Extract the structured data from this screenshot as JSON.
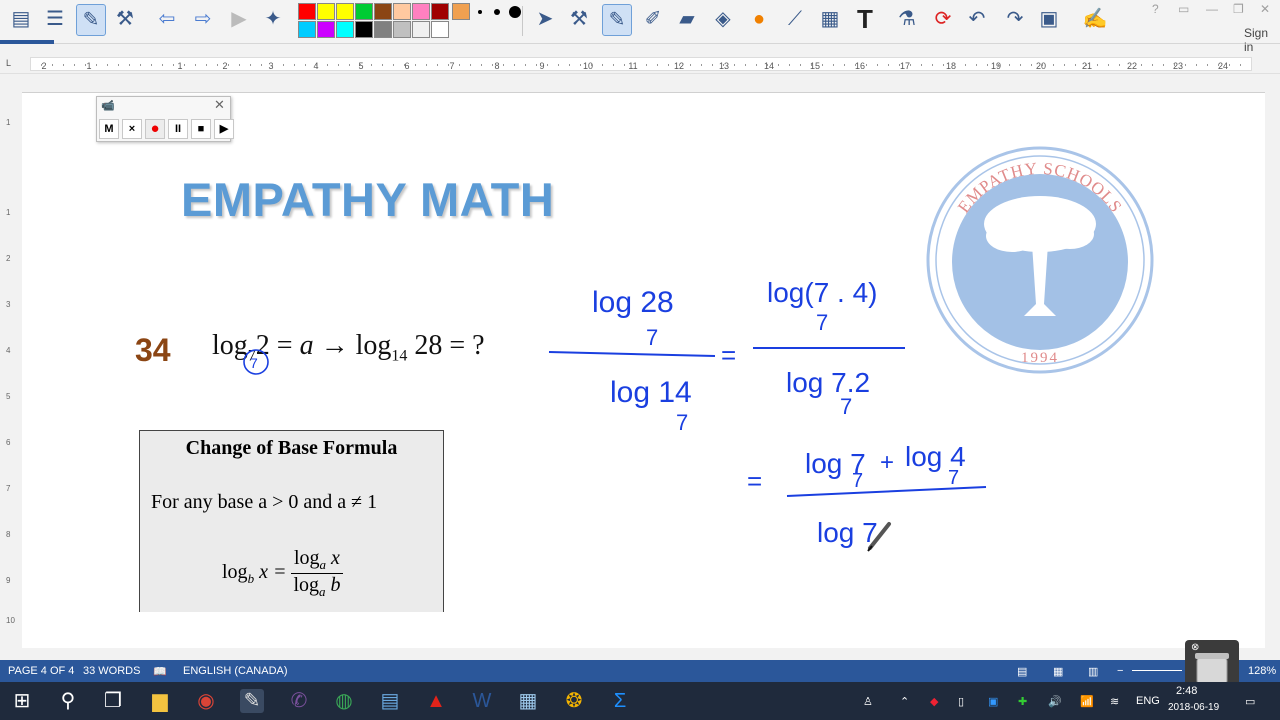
{
  "window": {
    "sign_in": "Sign in"
  },
  "colors": {
    "palette_row1": [
      "#ff0000",
      "#ffff00",
      "#ffff00",
      "#00cc33",
      "#8b4513",
      "#ffc9a0",
      "#ff80c0",
      "#a00000"
    ],
    "palette_row2": [
      "#00ccff",
      "#cc00ff",
      "#00ffff",
      "#000000",
      "#808080",
      "#c0c0c0",
      "#f0f0f0",
      "#ffffff"
    ],
    "accent": "#2b579a",
    "title_color": "#5b9bd5",
    "ink": "#1a3fe0"
  },
  "toolbar_icons": [
    "document-icon",
    "contacts-icon",
    "pen-mode-icon",
    "tools-icon",
    "back-icon",
    "forward-icon",
    "play-icon",
    "wand-icon",
    "pointer-icon",
    "settings-icon",
    "pen-icon",
    "marker-icon",
    "eraser-icon",
    "fill-icon",
    "shape-icon",
    "eyedropper-icon",
    "scene-icon",
    "text-icon",
    "flask-icon",
    "refresh-icon",
    "undo-icon",
    "redo-icon",
    "capture-icon",
    "edit-icon"
  ],
  "ruler": {
    "numbers": [
      "2",
      "1",
      "1",
      "2",
      "3",
      "4",
      "5",
      "6",
      "7",
      "8",
      "9",
      "10",
      "11",
      "12",
      "13",
      "14",
      "15",
      "16",
      "17",
      "18",
      "19",
      "20",
      "21",
      "22",
      "23",
      "24"
    ],
    "vertical": [
      "1",
      "1",
      "2",
      "3",
      "4",
      "5",
      "6",
      "7",
      "8",
      "9",
      "10"
    ]
  },
  "recorder": {
    "buttons": [
      "M",
      "×",
      "●",
      "II",
      "■",
      "▶"
    ]
  },
  "document": {
    "title": "EMPATHY MATH",
    "question_number": "34",
    "equation": {
      "part1": "log",
      "base1": "7",
      "part2": "2 = ",
      "var": "a",
      "part3": " → log",
      "base2": "14",
      "part4": " 28 = ?"
    },
    "formula_box": {
      "heading": "Change of Base Formula",
      "line": "For any base  a > 0  and  a ≠ 1",
      "lhs": "log",
      "lhs_base": "b",
      "lhs_arg": " x = ",
      "num": "log",
      "num_base": "a",
      "num_arg": " x",
      "den": "log",
      "den_base": "a",
      "den_arg": " b"
    },
    "handwriting": {
      "f1_num": "log 28",
      "f1_num_base": "7",
      "f1_den": "log 14",
      "f1_den_base": "7",
      "eq1": "=",
      "f2_num": "log(7 . 4)",
      "f2_num_base": "7",
      "f2_den": "log 7.2",
      "f2_den_base": "7",
      "eq2": "=",
      "f3_num_a": "log 7",
      "f3_num_a_base": "7",
      "f3_plus": "+",
      "f3_num_b": "log 4",
      "f3_num_b_base": "7",
      "f3_den": "log 7",
      "circled": "7"
    },
    "logo": {
      "arc_text": "EMPATHY SCHOOLS",
      "year": "1994"
    }
  },
  "status_bar": {
    "page": "PAGE 4 OF 4",
    "words": "33 WORDS",
    "language": "ENGLISH (CANADA)",
    "zoom": "128%"
  },
  "taskbar": {
    "apps": [
      "start-icon",
      "search-icon",
      "task-view-icon",
      "file-explorer-icon",
      "chrome-icon",
      "paint-icon",
      "viber-icon",
      "browser-icon",
      "network-icon",
      "acrobat-icon",
      "word-icon",
      "media-icon",
      "chrome-alt-icon",
      "sigma-icon"
    ],
    "lang": "ENG",
    "time": "2:48",
    "date": "2018-06-19"
  }
}
